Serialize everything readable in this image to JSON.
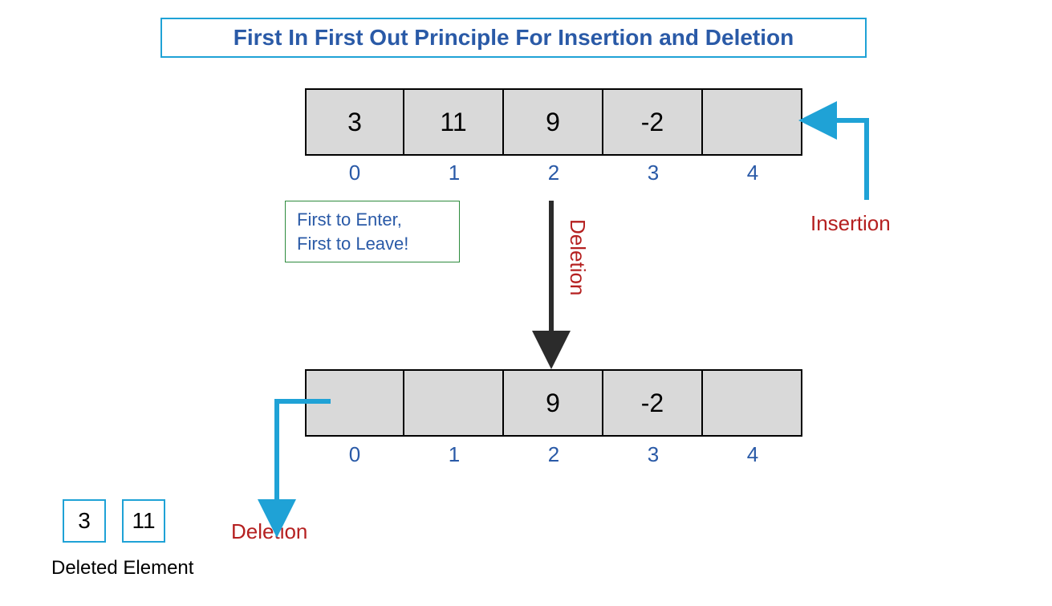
{
  "title": "First In First Out Principle For Insertion and Deletion",
  "queueTop": {
    "cells": [
      "3",
      "11",
      "9",
      "-2",
      ""
    ],
    "indices": [
      "0",
      "1",
      "2",
      "3",
      "4"
    ]
  },
  "queueBottom": {
    "cells": [
      "",
      "",
      "9",
      "-2",
      ""
    ],
    "indices": [
      "0",
      "1",
      "2",
      "3",
      "4"
    ]
  },
  "fifoNote": {
    "line1": "First to Enter,",
    "line2": "First to Leave!"
  },
  "labels": {
    "insertion": "Insertion",
    "deletionVertical": "Deletion",
    "deletionBottom": "Deletion",
    "deletedElement": "Deleted Element"
  },
  "deleted": {
    "box1": "3",
    "box2": "11"
  },
  "colors": {
    "titleBorder": "#1fa2d6",
    "titleText": "#2a5aa7",
    "cellBg": "#d9d9d9",
    "indexText": "#2a5aa7",
    "noteBorder": "#2e8b3d",
    "labelRed": "#b52020",
    "arrowCyan": "#1fa2d6",
    "arrowBlack": "#2b2b2b"
  }
}
